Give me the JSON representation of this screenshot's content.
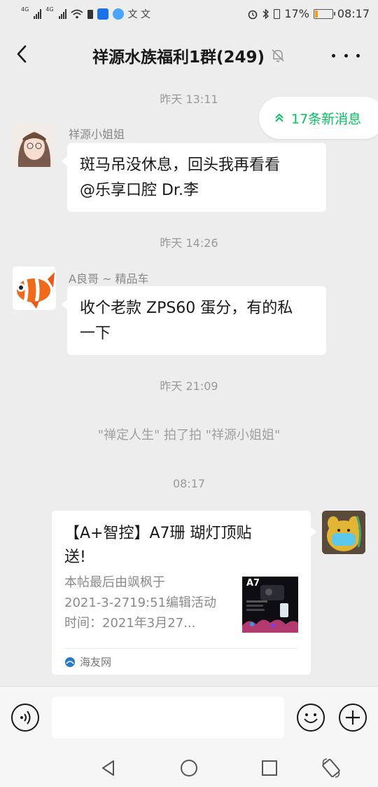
{
  "status_bar": {
    "network_left": "4G",
    "network_right": "4G",
    "battery_text": "17%",
    "time": "08:17",
    "battery_level": 0.17
  },
  "header": {
    "title": "祥源水族福利1群(249)",
    "mute_icon": "bell-off-icon",
    "back_icon": "chevron-left-icon",
    "more_icon": "more-dots-icon"
  },
  "new_messages_pill": "17条新消息",
  "messages": [
    {
      "type": "timestamp",
      "text": "昨天 13:11"
    },
    {
      "type": "text",
      "sender": "祥源小姐姐",
      "text_line1": "斑马吊没休息，回头我再看看",
      "text_line2": "@乐享口腔 Dr.李"
    },
    {
      "type": "timestamp",
      "text": "昨天 14:26"
    },
    {
      "type": "text",
      "sender": "A良哥 ~ 精品车",
      "text_line1": "收个老款 ZPS60 蛋分，有的私",
      "text_line2": "一下"
    },
    {
      "type": "timestamp",
      "text": "昨天 21:09"
    },
    {
      "type": "system",
      "text": "\"禅定人生\" 拍了拍 \"祥源小姐姐\""
    },
    {
      "type": "timestamp",
      "text": "08:17"
    },
    {
      "type": "link_card",
      "title_line1": "【A+智控】A7珊 瑚灯顶贴",
      "title_line2": "送!",
      "desc_line1": "本帖最后由飒枫于",
      "desc_line2": "2021-3-2719:51编辑活动",
      "desc_line3": "时间：2021年3月27...",
      "source": "海友网",
      "thumb_label": "A7"
    }
  ],
  "input_bar": {
    "voice_icon": "voice-icon",
    "emoji_icon": "emoji-icon",
    "plus_icon": "plus-icon",
    "input_value": ""
  },
  "system_nav": [
    "back-triangle-icon",
    "home-circle-icon",
    "recents-square-icon",
    "rotate-icon"
  ],
  "colors": {
    "accent": "#07c160",
    "background": "#ededed",
    "bubble": "#ffffff"
  }
}
